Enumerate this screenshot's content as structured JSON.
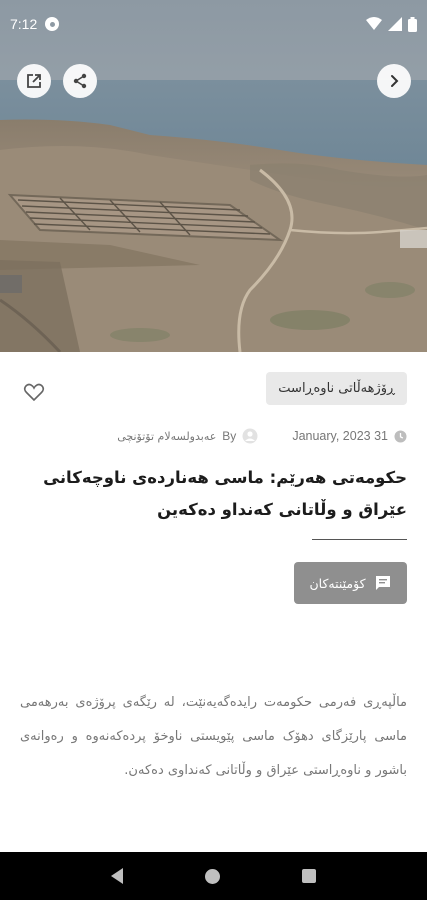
{
  "status_bar": {
    "time": "7:12"
  },
  "article": {
    "category": "ڕۆژهەڵاتی ناوەڕاست",
    "date": "January, 2023 31",
    "author_prefix": "By",
    "author": "عەبدولسەلام تۆتۆنچی",
    "title": "حکومەتی هەرێم: ماسی هەناردەی ناوچەکانی عێراق و وڵاتانی کەنداو دەکەین",
    "comments_label": "کۆمێنتەکان",
    "body": "ماڵپەڕی فەرمی حکومەت رایدەگەیەنێت، لە رێگەی پرۆژەی بەرهەمی ماسی پارێزگای دهۆک ماسی پێویستی ناوخۆ پردەکەنەوە و رەوانەی باشور و ناوەڕاستی عێراق و وڵاتانی کەنداوی دەکەن."
  },
  "colors": {
    "chip_bg": "#e9e9e9",
    "comments_bg": "#8f8f8f",
    "nav_bg": "#000000",
    "body_text": "#777777"
  },
  "icons": {
    "open_external": "open-external-icon",
    "share": "share-icon",
    "next": "chevron-right-icon",
    "favorite": "heart-outline-icon",
    "comments": "comment-icon",
    "author": "user-avatar-icon",
    "date": "clock-icon"
  }
}
